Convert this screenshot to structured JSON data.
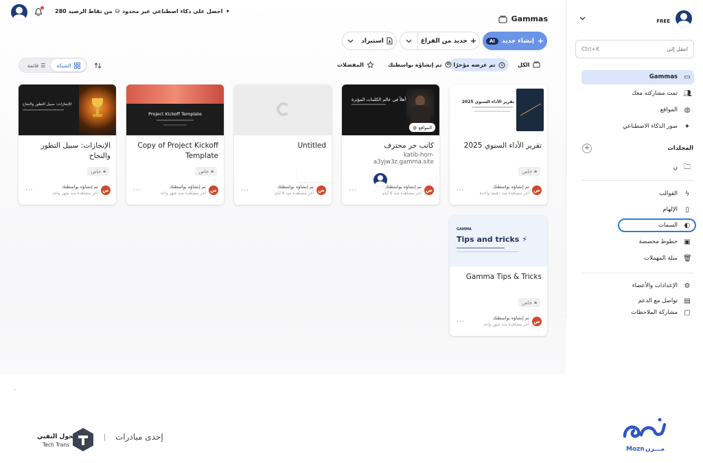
{
  "topbar": {
    "promo": "احصل على ذكاء اصطناعي غير محدود",
    "credits": "280 من نقاط الرصيد"
  },
  "workspace": {
    "title": "Gammas"
  },
  "actions": {
    "create_ai": "إنشاء جديد",
    "ai_badge": "AI",
    "new_blank": "جديد من الفراغ",
    "import": "استيراد"
  },
  "filters": {
    "all": "الكل",
    "recent": "تم عرضه مؤخرًا",
    "created_by_you": "تم إنشاؤه بواسطتك",
    "favorites": "المفضلات"
  },
  "view": {
    "grid": "الشبكة",
    "list": "قائمة"
  },
  "cards": [
    {
      "title": "تقرير الأداء السنوي 2025",
      "subtitle": "",
      "badge": "خاص",
      "by": "تم إنشاؤه بواسطتك",
      "seen": "آخر مشاهدة منذ دقيقة واحدة",
      "thumb_text": "تقرير الأداء السنوي 2025",
      "avatar": "ص"
    },
    {
      "title": "كاتب حر محترف",
      "subtitle": "katib-horr-a3yjw3z.gamma.site",
      "badge": "",
      "by": "تم إنشاؤه بواسطتك",
      "seen": "آخر مشاهدة منذ 6 أيام",
      "thumb_text": "أهلاً في عالم الكلمات المؤثرة",
      "site_label": "المواقع",
      "avatar": "ص"
    },
    {
      "title": "Untitled",
      "subtitle": "",
      "badge": "",
      "by": "تم إنشاؤه بواسطتك",
      "seen": "آخر مشاهدة منذ 6 أيام",
      "avatar": "ص"
    },
    {
      "title": "Copy of Project Kickoff Template",
      "subtitle": "",
      "badge": "خاص",
      "by": "تم إنشاؤه بواسطتك",
      "seen": "آخر مشاهدة منذ شهر واحد",
      "thumb_text": "Project Kickoff Template",
      "avatar": "ص"
    },
    {
      "title": "الإنجازات: سبيل التطور والنجاح",
      "subtitle": "",
      "badge": "خاص",
      "by": "تم إنشاؤه بواسطتك",
      "seen": "آخر مشاهدة منذ شهر واحد",
      "thumb_text": "الإنجازات: سبيل التطور والنجاح",
      "avatar": "ص"
    },
    {
      "title": "Gamma Tips & Tricks",
      "subtitle": "",
      "badge": "خاص",
      "by": "تم إنشاؤه بواسطتك",
      "seen": "آخر مشاهدة منذ شهر واحد",
      "thumb_text": "Tips and tricks ⚡",
      "thumb_brand": "GAMMA",
      "avatar": "ص"
    }
  ],
  "sidebar": {
    "plan": "FREE",
    "search_placeholder": "انتقل إلى",
    "search_shortcut": "Ctrl+K",
    "nav": [
      {
        "label": "Gammas",
        "icon": "stack-icon"
      },
      {
        "label": "تمت مشاركته معك",
        "icon": "shared-users-icon"
      },
      {
        "label": "المواقع",
        "icon": "globe-icon"
      },
      {
        "label": "صور الذكاء الاصطناعي",
        "icon": "sparkle-icon"
      }
    ],
    "folders_title": "المجلدات",
    "folder_item": "ن",
    "tools": [
      {
        "label": "القوالب",
        "icon": "lightning-icon"
      },
      {
        "label": "الإلهام",
        "icon": "book-icon"
      },
      {
        "label": "السمات",
        "icon": "palette-icon"
      },
      {
        "label": "خطوط مخصصة",
        "icon": "font-icon"
      },
      {
        "label": "سلة المهملات",
        "icon": "trash-icon"
      }
    ],
    "bottom": [
      {
        "label": "الإعدادات والأعضاء",
        "icon": "settings-icon"
      },
      {
        "label": "تواصل مع الدعم",
        "icon": "chat-icon"
      },
      {
        "label": "مشاركة الملاحظات",
        "icon": "feedback-icon"
      }
    ]
  },
  "footer": {
    "initiative": "إحدى مبادرات",
    "techtrans_ar": "التحول التقني",
    "techtrans_en": "Tech Trans",
    "mozn_en": "Mozn",
    "mozn_ar": "مـــزن"
  },
  "colors": {
    "accent": "#3b6fd6",
    "active_bg": "#dbe6fb",
    "avatar": "#d24a2c",
    "create_btn": "#6a94e8"
  }
}
